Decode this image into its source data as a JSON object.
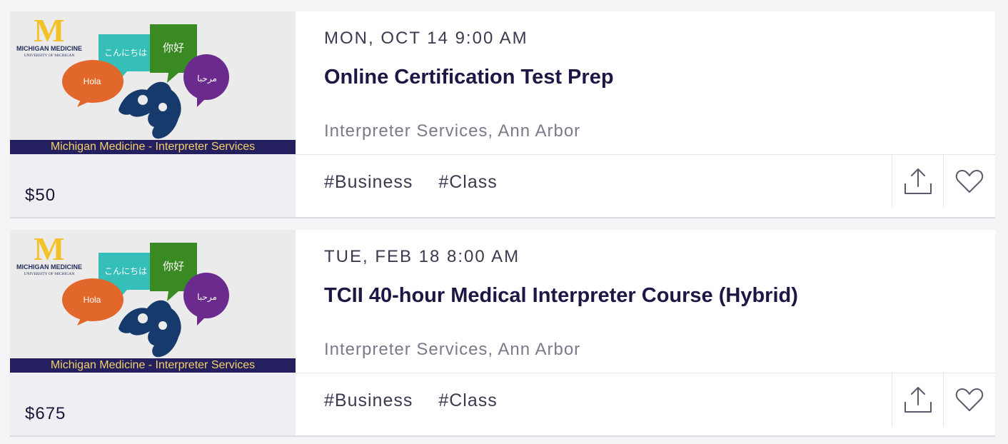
{
  "events": [
    {
      "date": "MON, OCT 14 9:00 AM",
      "title": "Online Certification Test Prep",
      "venue": "Interpreter Services, Ann Arbor",
      "price": "$50",
      "tags": [
        "#Business",
        "#Class"
      ],
      "image": {
        "logo_letter": "M",
        "logo_org": "MICHIGAN MEDICINE",
        "logo_sub": "UNIVERSITY OF MICHIGAN",
        "bubbles": [
          "Hola",
          "こんにちは",
          "你好",
          "مرحبا"
        ],
        "banner": "Michigan Medicine - Interpreter Services"
      },
      "actions": {
        "share_icon": "share-icon",
        "like_icon": "heart-icon"
      }
    },
    {
      "date": "TUE, FEB 18 8:00 AM",
      "title": "TCII 40-hour Medical Interpreter Course (Hybrid)",
      "venue": "Interpreter Services, Ann Arbor",
      "price": "$675",
      "tags": [
        "#Business",
        "#Class"
      ],
      "image": {
        "logo_letter": "M",
        "logo_org": "MICHIGAN MEDICINE",
        "logo_sub": "UNIVERSITY OF MICHIGAN",
        "bubbles": [
          "Hola",
          "こんにちは",
          "你好",
          "مرحبا"
        ],
        "banner": "Michigan Medicine - Interpreter Services"
      },
      "actions": {
        "share_icon": "share-icon",
        "like_icon": "heart-icon"
      }
    }
  ],
  "colors": {
    "title": "#1d1745",
    "banner_bg": "#241f5e",
    "banner_text": "#f3d36a",
    "maize": "#f2c22d",
    "bubble_orange": "#e2672a",
    "bubble_teal": "#35bfb8",
    "bubble_green": "#3a8a23",
    "bubble_purple": "#6a2a8e",
    "hands": "#163a6b"
  }
}
